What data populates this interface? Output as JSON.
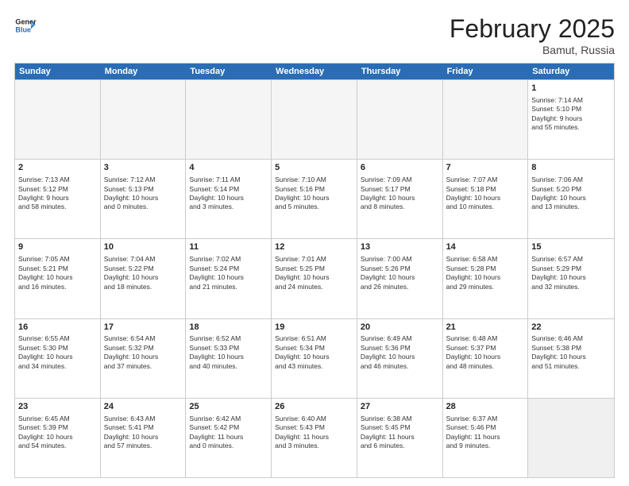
{
  "header": {
    "logo_general": "General",
    "logo_blue": "Blue",
    "month_title": "February 2025",
    "location": "Bamut, Russia"
  },
  "days_of_week": [
    "Sunday",
    "Monday",
    "Tuesday",
    "Wednesday",
    "Thursday",
    "Friday",
    "Saturday"
  ],
  "rows": [
    [
      {
        "day": "",
        "empty": true
      },
      {
        "day": "",
        "empty": true
      },
      {
        "day": "",
        "empty": true
      },
      {
        "day": "",
        "empty": true
      },
      {
        "day": "",
        "empty": true
      },
      {
        "day": "",
        "empty": true
      },
      {
        "day": "1",
        "lines": [
          "Sunrise: 7:14 AM",
          "Sunset: 5:10 PM",
          "Daylight: 9 hours",
          "and 55 minutes."
        ]
      }
    ],
    [
      {
        "day": "2",
        "lines": [
          "Sunrise: 7:13 AM",
          "Sunset: 5:12 PM",
          "Daylight: 9 hours",
          "and 58 minutes."
        ]
      },
      {
        "day": "3",
        "lines": [
          "Sunrise: 7:12 AM",
          "Sunset: 5:13 PM",
          "Daylight: 10 hours",
          "and 0 minutes."
        ]
      },
      {
        "day": "4",
        "lines": [
          "Sunrise: 7:11 AM",
          "Sunset: 5:14 PM",
          "Daylight: 10 hours",
          "and 3 minutes."
        ]
      },
      {
        "day": "5",
        "lines": [
          "Sunrise: 7:10 AM",
          "Sunset: 5:16 PM",
          "Daylight: 10 hours",
          "and 5 minutes."
        ]
      },
      {
        "day": "6",
        "lines": [
          "Sunrise: 7:09 AM",
          "Sunset: 5:17 PM",
          "Daylight: 10 hours",
          "and 8 minutes."
        ]
      },
      {
        "day": "7",
        "lines": [
          "Sunrise: 7:07 AM",
          "Sunset: 5:18 PM",
          "Daylight: 10 hours",
          "and 10 minutes."
        ]
      },
      {
        "day": "8",
        "lines": [
          "Sunrise: 7:06 AM",
          "Sunset: 5:20 PM",
          "Daylight: 10 hours",
          "and 13 minutes."
        ]
      }
    ],
    [
      {
        "day": "9",
        "lines": [
          "Sunrise: 7:05 AM",
          "Sunset: 5:21 PM",
          "Daylight: 10 hours",
          "and 16 minutes."
        ]
      },
      {
        "day": "10",
        "lines": [
          "Sunrise: 7:04 AM",
          "Sunset: 5:22 PM",
          "Daylight: 10 hours",
          "and 18 minutes."
        ]
      },
      {
        "day": "11",
        "lines": [
          "Sunrise: 7:02 AM",
          "Sunset: 5:24 PM",
          "Daylight: 10 hours",
          "and 21 minutes."
        ]
      },
      {
        "day": "12",
        "lines": [
          "Sunrise: 7:01 AM",
          "Sunset: 5:25 PM",
          "Daylight: 10 hours",
          "and 24 minutes."
        ]
      },
      {
        "day": "13",
        "lines": [
          "Sunrise: 7:00 AM",
          "Sunset: 5:26 PM",
          "Daylight: 10 hours",
          "and 26 minutes."
        ]
      },
      {
        "day": "14",
        "lines": [
          "Sunrise: 6:58 AM",
          "Sunset: 5:28 PM",
          "Daylight: 10 hours",
          "and 29 minutes."
        ]
      },
      {
        "day": "15",
        "lines": [
          "Sunrise: 6:57 AM",
          "Sunset: 5:29 PM",
          "Daylight: 10 hours",
          "and 32 minutes."
        ]
      }
    ],
    [
      {
        "day": "16",
        "lines": [
          "Sunrise: 6:55 AM",
          "Sunset: 5:30 PM",
          "Daylight: 10 hours",
          "and 34 minutes."
        ]
      },
      {
        "day": "17",
        "lines": [
          "Sunrise: 6:54 AM",
          "Sunset: 5:32 PM",
          "Daylight: 10 hours",
          "and 37 minutes."
        ]
      },
      {
        "day": "18",
        "lines": [
          "Sunrise: 6:52 AM",
          "Sunset: 5:33 PM",
          "Daylight: 10 hours",
          "and 40 minutes."
        ]
      },
      {
        "day": "19",
        "lines": [
          "Sunrise: 6:51 AM",
          "Sunset: 5:34 PM",
          "Daylight: 10 hours",
          "and 43 minutes."
        ]
      },
      {
        "day": "20",
        "lines": [
          "Sunrise: 6:49 AM",
          "Sunset: 5:36 PM",
          "Daylight: 10 hours",
          "and 46 minutes."
        ]
      },
      {
        "day": "21",
        "lines": [
          "Sunrise: 6:48 AM",
          "Sunset: 5:37 PM",
          "Daylight: 10 hours",
          "and 48 minutes."
        ]
      },
      {
        "day": "22",
        "lines": [
          "Sunrise: 6:46 AM",
          "Sunset: 5:38 PM",
          "Daylight: 10 hours",
          "and 51 minutes."
        ]
      }
    ],
    [
      {
        "day": "23",
        "lines": [
          "Sunrise: 6:45 AM",
          "Sunset: 5:39 PM",
          "Daylight: 10 hours",
          "and 54 minutes."
        ]
      },
      {
        "day": "24",
        "lines": [
          "Sunrise: 6:43 AM",
          "Sunset: 5:41 PM",
          "Daylight: 10 hours",
          "and 57 minutes."
        ]
      },
      {
        "day": "25",
        "lines": [
          "Sunrise: 6:42 AM",
          "Sunset: 5:42 PM",
          "Daylight: 11 hours",
          "and 0 minutes."
        ]
      },
      {
        "day": "26",
        "lines": [
          "Sunrise: 6:40 AM",
          "Sunset: 5:43 PM",
          "Daylight: 11 hours",
          "and 3 minutes."
        ]
      },
      {
        "day": "27",
        "lines": [
          "Sunrise: 6:38 AM",
          "Sunset: 5:45 PM",
          "Daylight: 11 hours",
          "and 6 minutes."
        ]
      },
      {
        "day": "28",
        "lines": [
          "Sunrise: 6:37 AM",
          "Sunset: 5:46 PM",
          "Daylight: 11 hours",
          "and 9 minutes."
        ]
      },
      {
        "day": "",
        "empty": true,
        "shaded": true
      }
    ]
  ]
}
